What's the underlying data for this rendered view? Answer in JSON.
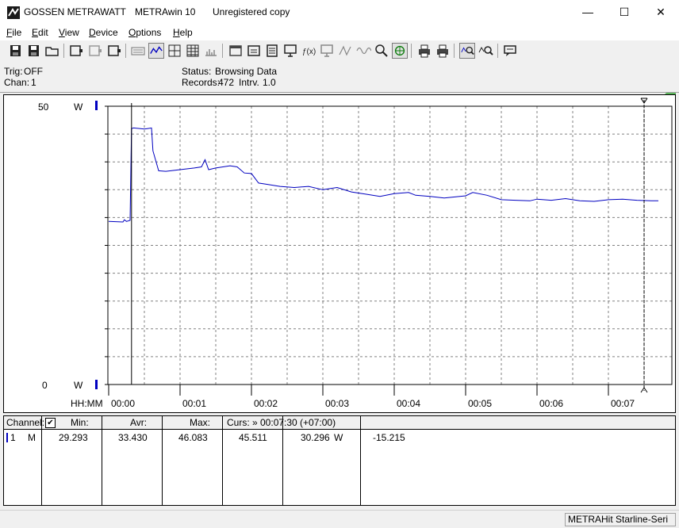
{
  "window": {
    "company": "GOSSEN METRAWATT",
    "app": "METRAwin 10",
    "license": "Unregistered copy",
    "controls": {
      "minimize": "—",
      "maximize": "☐",
      "close": "✕"
    }
  },
  "menu": [
    {
      "id": "file",
      "pre": "",
      "ul": "F",
      "post": "ile"
    },
    {
      "id": "edit",
      "pre": "",
      "ul": "E",
      "post": "dit"
    },
    {
      "id": "view",
      "pre": "",
      "ul": "V",
      "post": "iew"
    },
    {
      "id": "device",
      "pre": "",
      "ul": "D",
      "post": "evice"
    },
    {
      "id": "options",
      "pre": "",
      "ul": "O",
      "post": "ptions"
    },
    {
      "id": "help",
      "pre": "",
      "ul": "H",
      "post": "elp"
    }
  ],
  "status": {
    "trig_label": "Trig:",
    "trig_value": "OFF",
    "chan_label": "Chan:",
    "chan_value": "1",
    "status_label": "Status:",
    "status_value": "Browsing Data",
    "records_label": "Records:",
    "records_value": "472",
    "intrv_label": "Intrv.",
    "intrv_value": "1.0"
  },
  "chart_data": {
    "type": "line",
    "ylim": [
      0,
      50
    ],
    "y_top_label": "50",
    "y_bottom_label": "0",
    "y_unit": "W",
    "x_unit_label": "HH:MM",
    "x_tick_labels": [
      "00:00",
      "00:01",
      "00:02",
      "00:03",
      "00:04",
      "00:05",
      "00:06",
      "00:07"
    ],
    "cursor1_time_min": 0.32,
    "cursor2_time_min": 7.5,
    "grid": true,
    "series": [
      {
        "color": "#0000c0",
        "x": [
          0.0,
          0.2,
          0.22,
          0.25,
          0.3,
          0.32,
          0.35,
          0.5,
          0.55,
          0.6,
          0.62,
          0.7,
          0.8,
          1.0,
          1.2,
          1.3,
          1.35,
          1.4,
          1.5,
          1.7,
          1.8,
          1.9,
          2.0,
          2.1,
          2.2,
          2.4,
          2.6,
          2.8,
          3.0,
          3.2,
          3.4,
          3.6,
          3.8,
          4.0,
          4.2,
          4.3,
          4.5,
          4.7,
          5.0,
          5.1,
          5.3,
          5.5,
          5.7,
          5.9,
          6.0,
          6.2,
          6.4,
          6.6,
          6.8,
          7.0,
          7.2,
          7.4,
          7.6,
          7.7
        ],
        "y": [
          29.3,
          29.2,
          29.6,
          29.3,
          29.5,
          46.0,
          46.1,
          45.9,
          46.0,
          46.1,
          42.0,
          38.4,
          38.3,
          38.6,
          38.9,
          39.1,
          40.4,
          38.6,
          38.9,
          39.3,
          39.1,
          38.0,
          37.9,
          36.2,
          36.0,
          35.6,
          35.4,
          35.6,
          35.0,
          35.4,
          34.6,
          34.2,
          33.8,
          34.3,
          34.5,
          34.0,
          33.8,
          33.5,
          33.9,
          34.5,
          34.0,
          33.2,
          33.1,
          33.0,
          33.3,
          33.1,
          33.4,
          33.0,
          32.9,
          33.2,
          33.3,
          33.1,
          33.0,
          33.0
        ]
      }
    ]
  },
  "table": {
    "headers": {
      "channel": "Channel:",
      "checkbox": "✔",
      "min": "Min:",
      "avr": "Avr:",
      "max": "Max:",
      "curs": "Curs: » 00:07:30 (+07:00)"
    },
    "row": {
      "num": "1",
      "mode": "M",
      "min": "29.293",
      "avr": "33.430",
      "max": "46.083",
      "curs_val1": "45.511",
      "curs_val2": "30.296",
      "unit": "W",
      "diff": "-15.215"
    }
  },
  "statusbar": {
    "device": "METRAHit Starline-Seri"
  }
}
